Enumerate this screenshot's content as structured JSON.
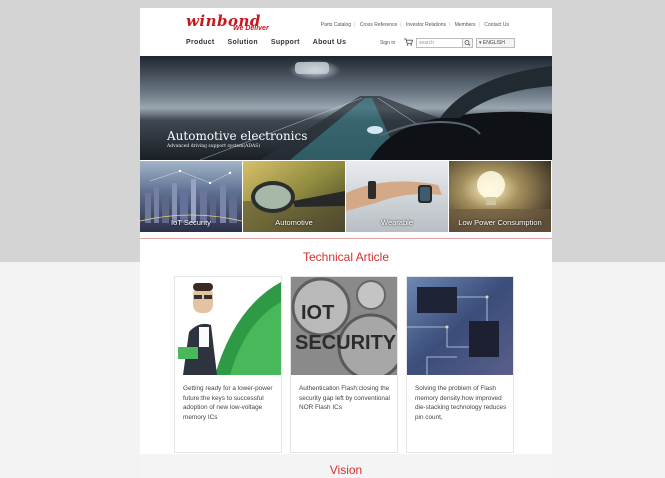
{
  "header": {
    "logo_text": "winbond",
    "tagline": "We Deliver",
    "top_links": [
      "Parts Catalog",
      "Cross Reference",
      "Investor Relations",
      "Members",
      "Contact Us"
    ],
    "nav": [
      "Product",
      "Solution",
      "Support",
      "About Us"
    ],
    "signin": "Sign in",
    "search_placeholder": "search",
    "language": "ENGLISH"
  },
  "hero": {
    "title": "Automotive electronics",
    "subtitle": "Advanced driving support system(ADAS)",
    "slide_count": 3,
    "active_slide": 3
  },
  "tiles": [
    {
      "label": "IoT Security"
    },
    {
      "label": "Automotive"
    },
    {
      "label": "Wearable"
    },
    {
      "label": "Low Power Consumption"
    }
  ],
  "technical_article": {
    "title": "Technical Article",
    "cards": [
      {
        "text": "Getting ready for a lower-power future:the keys to successful adoption of new low-voltage memory ICs"
      },
      {
        "text": "Authentication Flash:closing the security gap left by conventional NOR Flash ICs"
      },
      {
        "text": "Solving the problem of Flash memory density:how improved die-stacking technology reduces pin count,"
      }
    ]
  },
  "vision": {
    "title": "Vision"
  },
  "colors": {
    "brand": "#c8161d",
    "accent": "#d2322d"
  }
}
